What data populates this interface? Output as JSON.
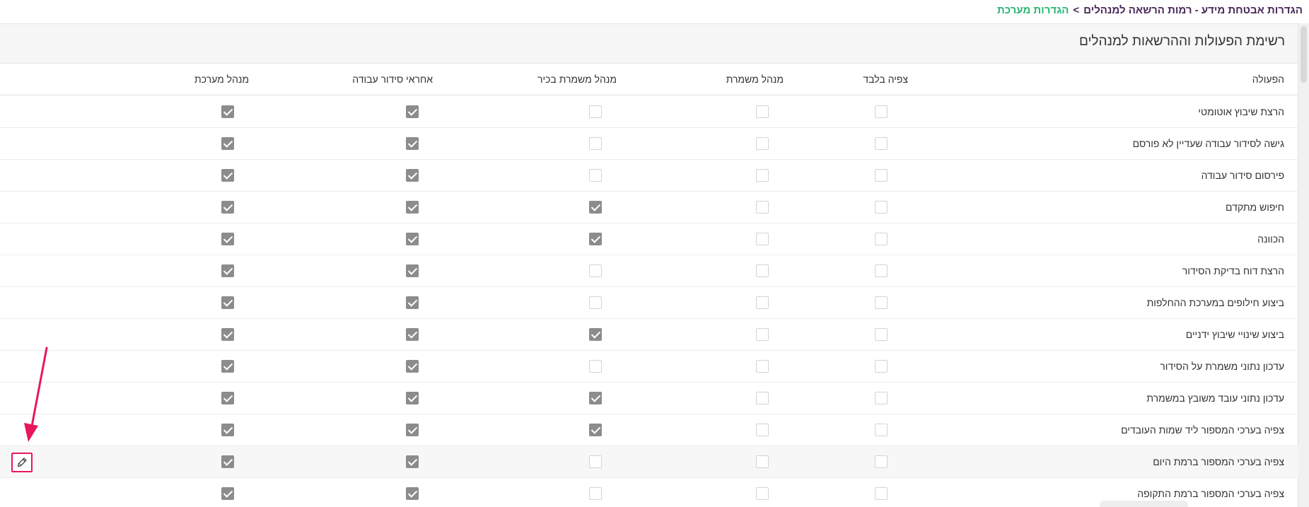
{
  "breadcrumb": {
    "root": "הגדרות מערכת",
    "separator": ">",
    "current": "הגדרות אבטחת מידע - רמות הרשאה למנהלים"
  },
  "panel": {
    "title": "רשימת הפעולות וההרשאות למנהלים"
  },
  "table": {
    "headers": {
      "action": "הפעולה",
      "view_only": "צפיה בלבד",
      "shift_manager": "מנהל משמרת",
      "senior_shift_manager": "מנהל משמרת בכיר",
      "schedule_owner": "אחראי סידור עבודה",
      "system_admin": "מנהל מערכת"
    },
    "rows": [
      {
        "action": "הרצת שיבוץ אוטומטי",
        "perms": [
          false,
          false,
          false,
          true,
          true
        ]
      },
      {
        "action": "גישה לסידור עבודה שעדיין לא פורסם",
        "perms": [
          false,
          false,
          false,
          true,
          true
        ]
      },
      {
        "action": "פירסום סידור עבודה",
        "perms": [
          false,
          false,
          false,
          true,
          true
        ]
      },
      {
        "action": "חיפוש מתקדם",
        "perms": [
          false,
          false,
          true,
          true,
          true
        ]
      },
      {
        "action": "הכוונה",
        "perms": [
          false,
          false,
          true,
          true,
          true
        ]
      },
      {
        "action": "הרצת דוח בדיקת הסידור",
        "perms": [
          false,
          false,
          false,
          true,
          true
        ]
      },
      {
        "action": "ביצוע חילופים במערכת ההחלפות",
        "perms": [
          false,
          false,
          false,
          true,
          true
        ]
      },
      {
        "action": "ביצוע שינויי שיבוץ ידניים",
        "perms": [
          false,
          false,
          true,
          true,
          true
        ]
      },
      {
        "action": "עדכון נתוני משמרת על הסידור",
        "perms": [
          false,
          false,
          false,
          true,
          true
        ]
      },
      {
        "action": "עדכון נתוני עובד משובץ במשמרת",
        "perms": [
          false,
          false,
          true,
          true,
          true
        ]
      },
      {
        "action": "צפיה בערכי המספור ליד שמות העובדים",
        "perms": [
          false,
          false,
          true,
          true,
          true
        ]
      },
      {
        "action": "צפיה בערכי המספור ברמת היום",
        "perms": [
          false,
          false,
          false,
          true,
          true
        ]
      },
      {
        "action": "צפיה בערכי המספור ברמת התקופה",
        "perms": [
          false,
          false,
          false,
          true,
          true
        ]
      }
    ],
    "highlighted_row_index": 11
  },
  "edit_button": {
    "icon": "pencil-icon"
  },
  "colors": {
    "accent_link": "#2bb673",
    "breadcrumb_text": "#4a2a5a",
    "checked": "#8c8c8c",
    "annotation": "#e8175d"
  }
}
